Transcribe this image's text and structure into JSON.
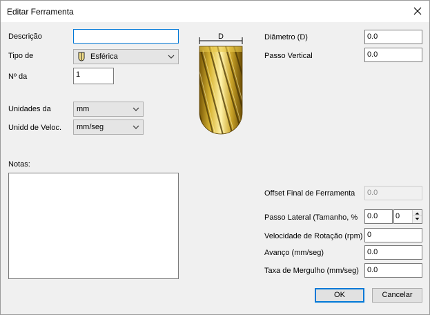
{
  "window": {
    "title": "Editar Ferramenta",
    "close_icon": "close-icon"
  },
  "left": {
    "description_label": "Descrição",
    "description_value": "",
    "type_label": "Tipo de",
    "type_value": "Esférica",
    "type_icon": "ball-end-tool-icon",
    "number_label": "Nº da",
    "number_value": "1",
    "units_label": "Unidades da",
    "units_value": "mm",
    "speed_units_label": "Unidd de Veloc.",
    "speed_units_value": "mm/seg",
    "notes_label": "Notas:",
    "notes_value": ""
  },
  "diagram": {
    "dimension_label": "D",
    "tool_color": "#c9a227"
  },
  "right": {
    "diameter_label": "Diâmetro (D)",
    "diameter_value": "0.0",
    "vertical_step_label": "Passo Vertical",
    "vertical_step_value": "0.0",
    "offset_label": "Offset Final de Ferramenta",
    "offset_value": "0.0",
    "lateral_step_label": "Passo Lateral (Tamanho, %",
    "lateral_step_size": "0.0",
    "lateral_step_percent": "0",
    "rotation_label": "Velocidade de Rotação (rpm)",
    "rotation_value": "0",
    "feed_label": "Avanço (mm/seg)",
    "feed_value": "0.0",
    "plunge_label": "Taxa de Mergulho (mm/seg)",
    "plunge_value": "0.0"
  },
  "buttons": {
    "ok": "OK",
    "cancel": "Cancelar"
  },
  "colors": {
    "focus": "#0078d7",
    "background": "#f0f0f0",
    "tool_gold": "#c9a227"
  }
}
